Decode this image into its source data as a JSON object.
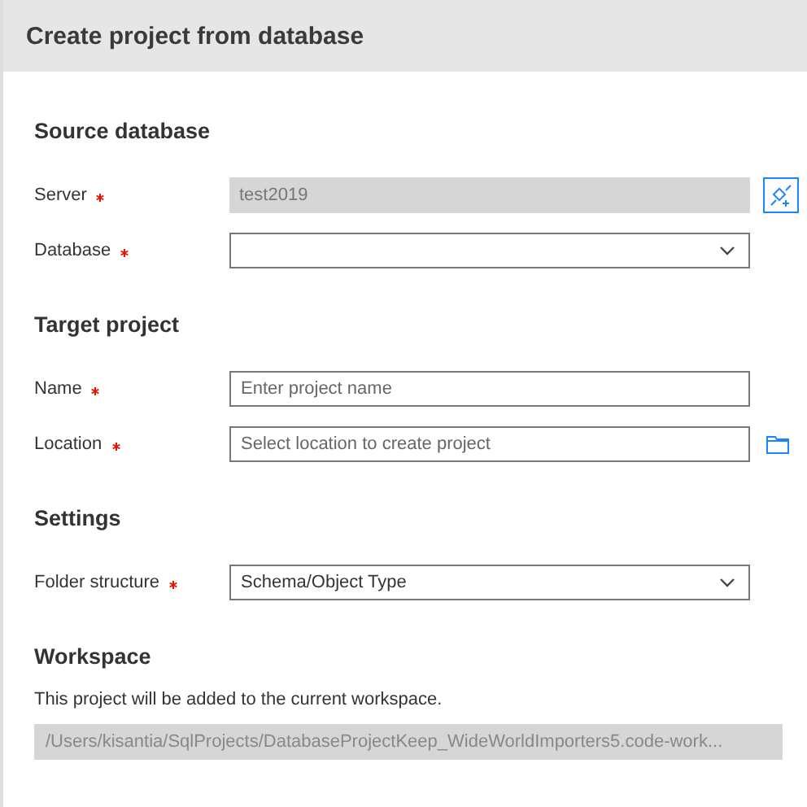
{
  "dialog": {
    "title": "Create project from database"
  },
  "sections": [
    {
      "title": "Source database",
      "fields": [
        {
          "label": "Server",
          "required": true,
          "kind": "readonly",
          "value": "test2019",
          "trailing": {
            "kind": "connect"
          }
        },
        {
          "label": "Database",
          "required": true,
          "kind": "dropdown"
        }
      ]
    },
    {
      "title": "Target project",
      "fields": [
        {
          "label": "Name",
          "required": true,
          "kind": "text",
          "placeholder": "Enter project name"
        },
        {
          "label": "Location",
          "required": true,
          "kind": "text",
          "placeholder": "Select location to create project",
          "trailing": {
            "kind": "browse"
          }
        }
      ]
    },
    {
      "title": "Settings",
      "fields": [
        {
          "label": "Folder structure",
          "required": true,
          "kind": "dropdown",
          "value": "Schema/Object Type"
        }
      ]
    }
  ],
  "workspace": {
    "title": "Workspace",
    "description": "This project will be added to the current workspace.",
    "path": "/Users/kisantia/SqlProjects/DatabaseProjectKeep_WideWorldImporters5.code-work..."
  }
}
